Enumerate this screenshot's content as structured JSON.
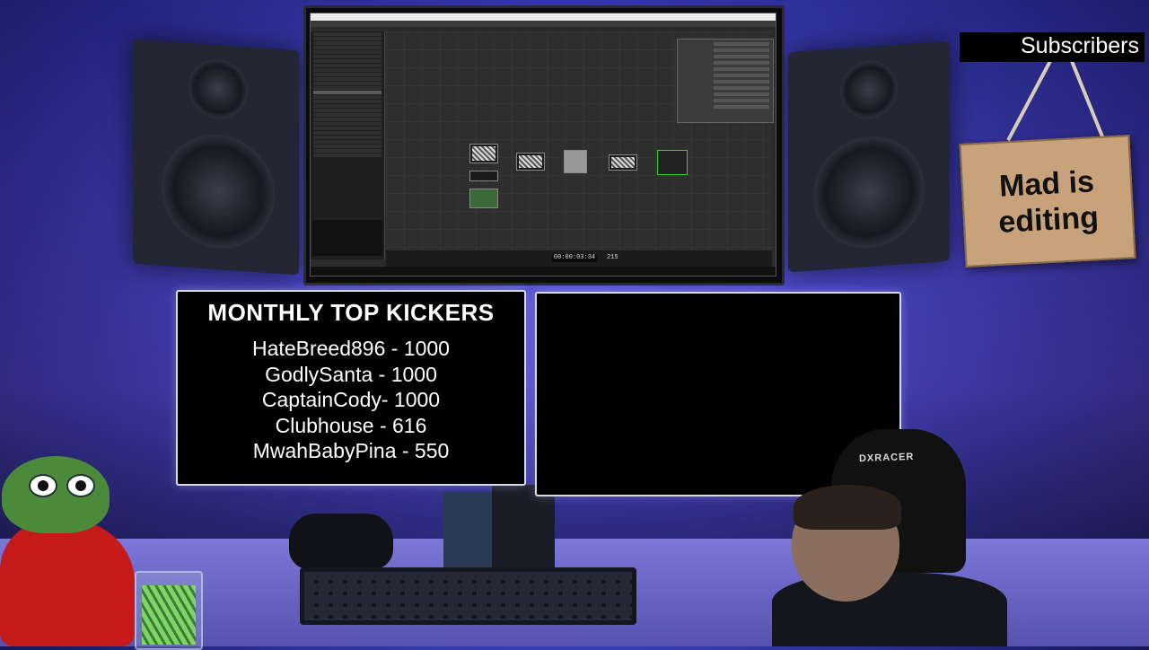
{
  "overlay": {
    "subscribers_label": "Subscribers",
    "sign_line1": "Mad is",
    "sign_line2": "editing",
    "kickers": {
      "title": "MONTHLY TOP KICKERS",
      "entries": [
        "HateBreed896 - 1000",
        "GodlySanta - 1000",
        "CaptainCody- 1000",
        "Clubhouse - 616",
        "MwahBabyPina - 550"
      ]
    }
  },
  "screen": {
    "timecode": "00:00:03:34",
    "frame": "215"
  },
  "decor": {
    "chair_brand": "DXRACER"
  },
  "colors": {
    "wall_light": "#5a64e0",
    "panel_bg": "#000000",
    "sign_wood": "#c8a27a",
    "pepe_green": "#4a8a3a",
    "pepe_red": "#c41a1a"
  }
}
